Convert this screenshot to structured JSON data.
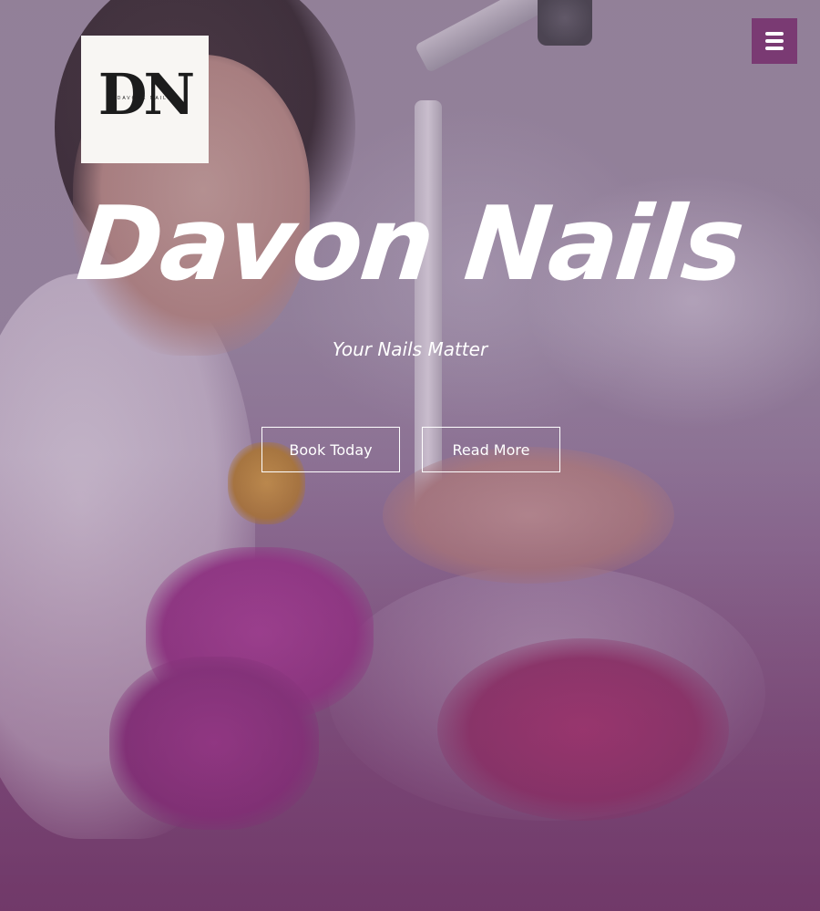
{
  "logo": {
    "letters": "DN",
    "subtext": "DAVONE NAILS"
  },
  "hero": {
    "title": "Davon Nails",
    "tagline": "Your Nails Matter",
    "book_label": "Book Today",
    "read_label": "Read More"
  },
  "menu": {
    "icon": "hamburger-icon",
    "color": "#7a3a73"
  },
  "colors": {
    "accent": "#7a3a73",
    "text": "#ffffff",
    "logo_bg": "#f8f6f3"
  }
}
